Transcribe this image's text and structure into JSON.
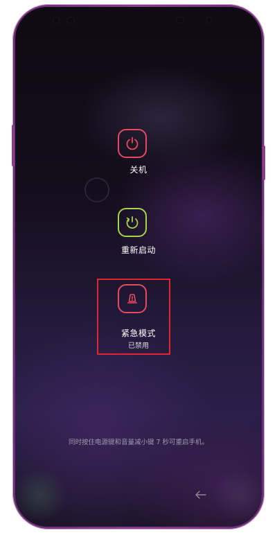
{
  "power_menu": {
    "power_off": {
      "label": "关机",
      "icon": "power-icon",
      "color": "#e84a5f"
    },
    "restart": {
      "label": "重新启动",
      "icon": "restart-icon",
      "color": "#a6d64a"
    },
    "emergency": {
      "label": "紧急模式",
      "status": "已禁用",
      "icon": "emergency-icon",
      "color": "#e84a5f"
    }
  },
  "hint": "同时按住电源键和音量减小键 7 秒可重启手机。",
  "highlight_color": "#e0262e"
}
